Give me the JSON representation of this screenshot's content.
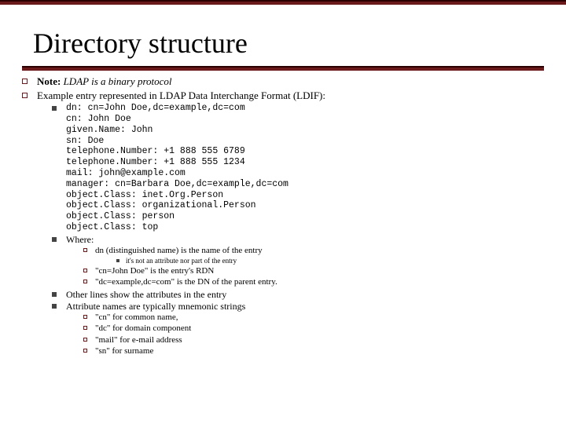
{
  "title": "Directory structure",
  "b1": {
    "prefix": "Note:",
    "italic": "LDAP is a binary protocol"
  },
  "b2": "Example entry represented in LDAP Data Interchange Format (LDIF):",
  "code": "dn: cn=John Doe,dc=example,dc=com\ncn: John Doe\ngiven.Name: John\nsn: Doe\ntelephone.Number: +1 888 555 6789\ntelephone.Number: +1 888 555 1234\nmail: john@example.com\nmanager: cn=Barbara Doe,dc=example,dc=com\nobject.Class: inet.Org.Person\nobject.Class: organizational.Person\nobject.Class: person\nobject.Class: top",
  "b3": "Where:",
  "b3a": "dn (distinguished name) is the name of the entry",
  "b3a1": "it's not an attribute nor part of the entry",
  "b3b": "\"cn=John Doe\" is the entry's RDN",
  "b3c": "\"dc=example,dc=com\" is the DN of the parent entry.",
  "b4": "Other lines show the attributes in the entry",
  "b5": "Attribute names are typically mnemonic strings",
  "b5a": "\"cn\" for common name,",
  "b5b": "\"dc\" for domain component",
  "b5c": "\"mail\" for e-mail address",
  "b5d": "\"sn\" for surname"
}
